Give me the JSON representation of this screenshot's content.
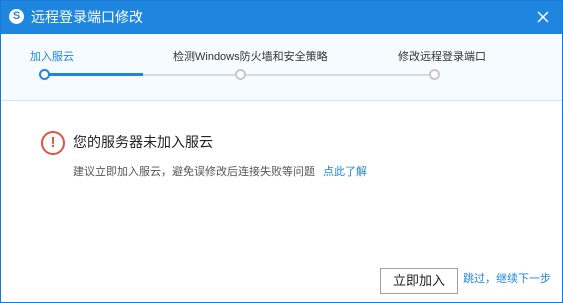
{
  "window": {
    "title": "远程登录端口修改",
    "app_icon": "S",
    "close_icon": "close-icon"
  },
  "steps": [
    {
      "label": "加入服云",
      "state": "active"
    },
    {
      "label": "检测Windows防火墙和安全策略",
      "state": "pending"
    },
    {
      "label": "修改远程登录端口",
      "state": "pending"
    }
  ],
  "progress": {
    "current_step": 1,
    "total_steps": 3
  },
  "notice": {
    "icon": "!",
    "title": "您的服务器未加入服云",
    "description": "建议立即加入服云，避免误修改后连接失败等问题",
    "link": "点此了解"
  },
  "footer": {
    "join_label": "立即加入",
    "skip_label": "跳过，继续下一步"
  },
  "colors": {
    "accent": "#1f86e0",
    "warning": "#e0533f"
  }
}
